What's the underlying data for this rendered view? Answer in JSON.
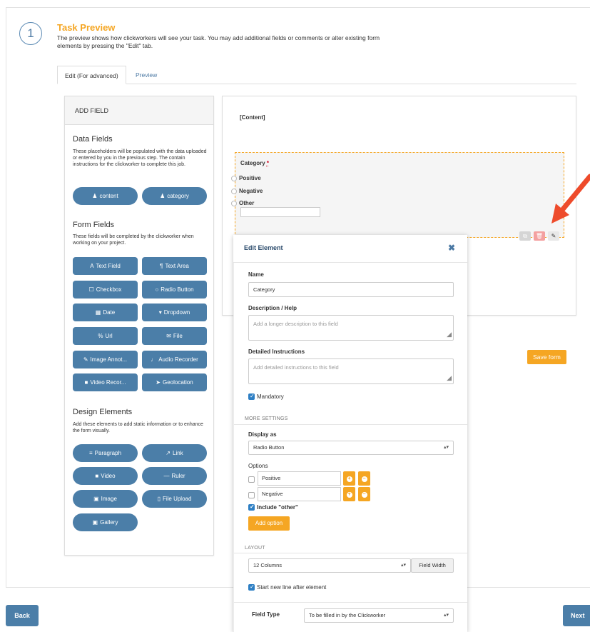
{
  "step": {
    "number": "1",
    "title": "Task Preview",
    "description": "The preview shows how clickworkers will see your task. You may add additional fields or comments or alter existing form elements by pressing the \"Edit\" tab."
  },
  "tabs": [
    {
      "label": "Edit (For advanced)",
      "active": true
    },
    {
      "label": "Preview",
      "active": false
    }
  ],
  "add_field": {
    "header": "ADD FIELD",
    "data_fields": {
      "title": "Data Fields",
      "description": "These placeholders will be populated with the data uploaded or entered by you in the previous step. The contain instructions for the clickworker to complete this job.",
      "items": [
        "content",
        "category"
      ]
    },
    "form_fields": {
      "title": "Form Fields",
      "description": "These fields will be completed by the clickworker when working on your project.",
      "items": [
        "Text Field",
        "Text Area",
        "Checkbox",
        "Radio Button",
        "Date",
        "Dropdown",
        "Url",
        "File",
        "Image Annot...",
        "Audio Recorder",
        "Video Recor...",
        "Geolocation"
      ]
    },
    "design_elements": {
      "title": "Design Elements",
      "description": "Add these elements to add static information or to enhance the form visually.",
      "items": [
        "Paragraph",
        "Link",
        "Video",
        "Ruler",
        "Image",
        "File Upload",
        "Gallery"
      ]
    }
  },
  "preview": {
    "content_label": "[Content]",
    "category_label": "Category",
    "required_mark": "*",
    "options": [
      "Positive",
      "Negative",
      "Other"
    ]
  },
  "save_form_label": "Save form",
  "edit_element": {
    "title": "Edit Element",
    "close": "✖",
    "name_label": "Name",
    "name_value": "Category",
    "description_label": "Description / Help",
    "description_placeholder": "Add a longer description to this field",
    "instructions_label": "Detailed Instructions",
    "instructions_placeholder": "Add detailed instructions to this field",
    "mandatory_label": "Mandatory",
    "more_settings": "MORE SETTINGS",
    "display_as_label": "Display as",
    "display_as_value": "Radio Button",
    "options_label": "Options",
    "options": [
      "Positive",
      "Negative"
    ],
    "include_other_label": "Include \"other\"",
    "add_option_label": "Add option",
    "layout_heading": "LAYOUT",
    "columns_value": "12 Columns",
    "field_width_label": "Field Width",
    "start_new_line_label": "Start new line after element",
    "field_type_label": "Field Type",
    "field_type_value": "To be filled in by the Clickworker"
  },
  "nav": {
    "back": "Back",
    "next": "Next"
  },
  "colors": {
    "accent_orange": "#f5a623",
    "button_blue": "#4b7ea8",
    "arrow_red": "#ee4b2b"
  }
}
